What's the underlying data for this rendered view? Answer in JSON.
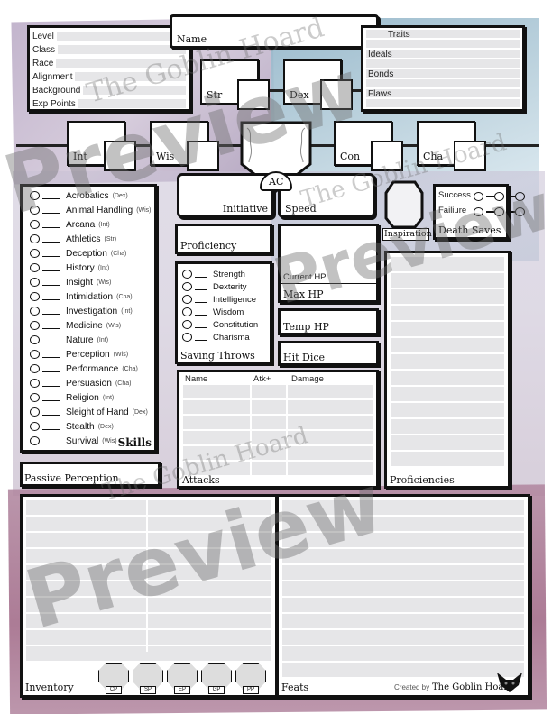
{
  "watermark": {
    "preview": "Preview",
    "brand": "The Goblin Hoard"
  },
  "character_info": {
    "fields": [
      "Level",
      "Class",
      "Race",
      "Alignment",
      "Background",
      "Exp Points"
    ]
  },
  "name_box": {
    "label": "Name"
  },
  "personality": {
    "fields": [
      "Traits",
      "Ideals",
      "Bonds",
      "Flaws"
    ]
  },
  "abilities": {
    "str": "Str",
    "dex": "Dex",
    "int": "Int",
    "wis": "Wis",
    "con": "Con",
    "cha": "Cha"
  },
  "combat": {
    "ac": "AC",
    "initiative": "Initiative",
    "speed": "Speed",
    "inspiration": "Inspiration",
    "proficiency": "Proficiency"
  },
  "death_saves": {
    "title": "Death Saves",
    "success": "Success",
    "failure": "Failiure"
  },
  "skills": {
    "title": "Skills",
    "items": [
      {
        "name": "Acrobatics",
        "ability": "(Dex)"
      },
      {
        "name": "Animal Handling",
        "ability": "(Wis)"
      },
      {
        "name": "Arcana",
        "ability": "(Int)"
      },
      {
        "name": "Athletics",
        "ability": "(Str)"
      },
      {
        "name": "Deception",
        "ability": "(Cha)"
      },
      {
        "name": "History",
        "ability": "(Int)"
      },
      {
        "name": "Insight",
        "ability": "(Wis)"
      },
      {
        "name": "Intimidation",
        "ability": "(Cha)"
      },
      {
        "name": "Investigation",
        "ability": "(Int)"
      },
      {
        "name": "Medicine",
        "ability": "(Wis)"
      },
      {
        "name": "Nature",
        "ability": "(Int)"
      },
      {
        "name": "Perception",
        "ability": "(Wis)"
      },
      {
        "name": "Performance",
        "ability": "(Cha)"
      },
      {
        "name": "Persuasion",
        "ability": "(Cha)"
      },
      {
        "name": "Religion",
        "ability": "(Int)"
      },
      {
        "name": "Sleight of Hand",
        "ability": "(Dex)"
      },
      {
        "name": "Stealth",
        "ability": "(Dex)"
      },
      {
        "name": "Survival",
        "ability": "(Wis)"
      }
    ]
  },
  "passive_perception": {
    "label": "Passive Perception"
  },
  "saving_throws": {
    "title": "Saving Throws",
    "items": [
      "Strength",
      "Dexterity",
      "Intelligence",
      "Wisdom",
      "Constitution",
      "Charisma"
    ]
  },
  "hp": {
    "current": "Current HP",
    "max": "Max HP",
    "temp": "Temp HP",
    "hit_dice": "Hit Dice"
  },
  "attacks": {
    "title": "Attacks",
    "columns": [
      "Name",
      "Atk+",
      "Damage"
    ]
  },
  "proficiencies": {
    "title": "Proficiencies"
  },
  "inventory": {
    "title": "Inventory",
    "coins": [
      "CP",
      "SP",
      "EP",
      "GP",
      "PP"
    ]
  },
  "feats": {
    "title": "Feats"
  },
  "credit": {
    "prefix": "Created by",
    "brand": "The Goblin Hoard"
  }
}
